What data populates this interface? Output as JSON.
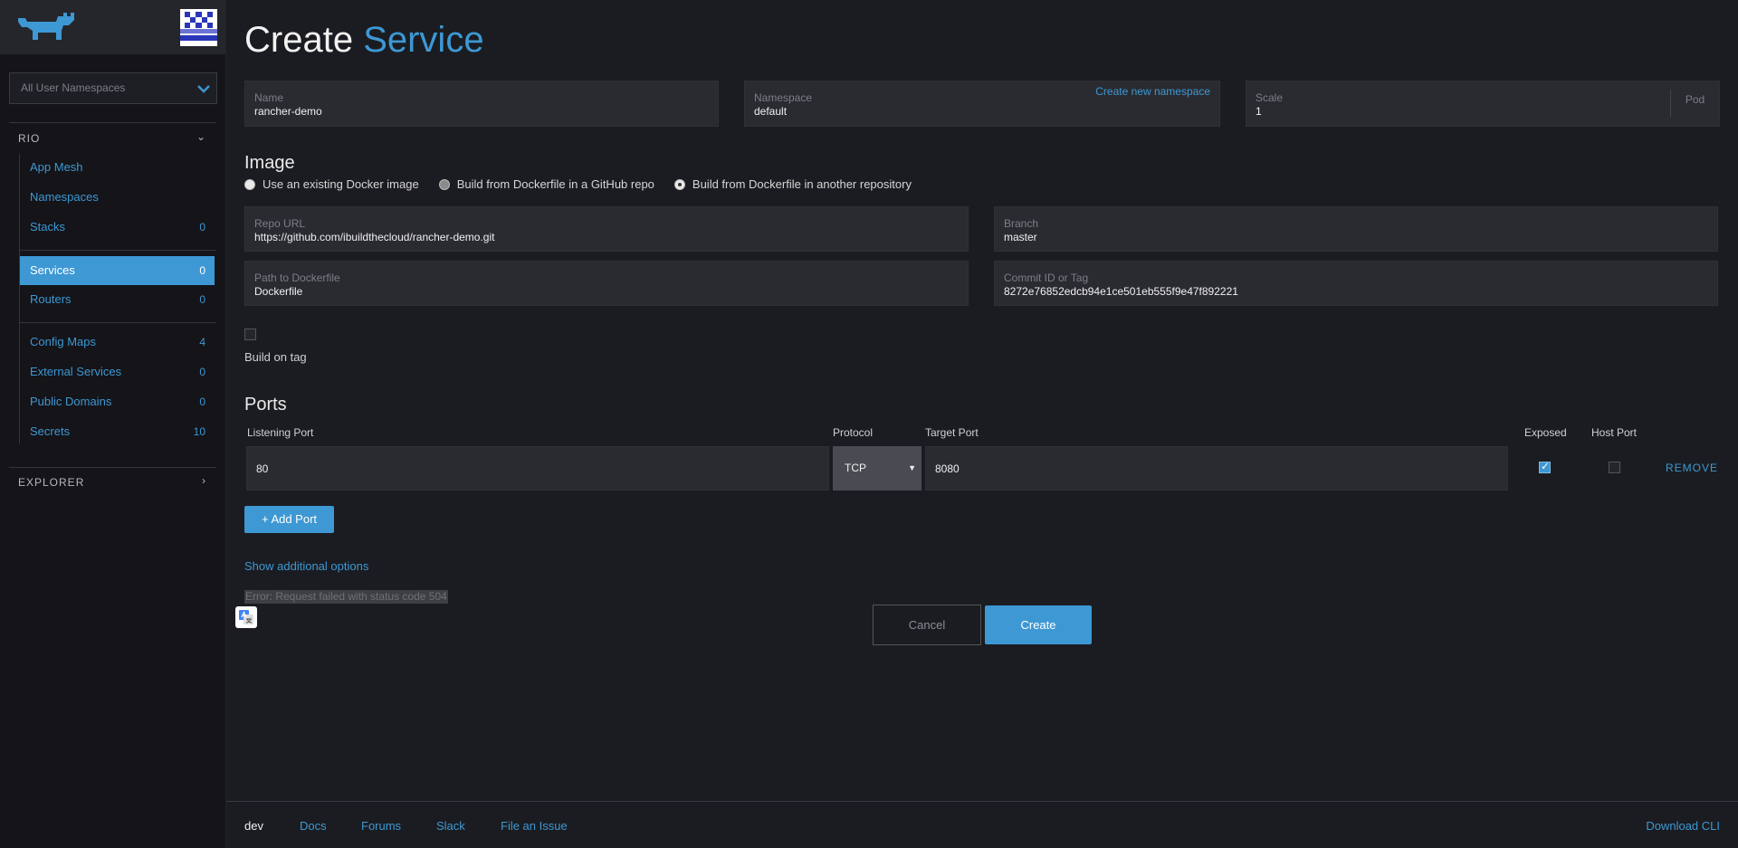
{
  "sidebar": {
    "namespace_select": "All User Namespaces",
    "groups": [
      {
        "title": "RIO",
        "caret": "⌄"
      },
      {
        "title": "EXPLORER",
        "caret": "›"
      }
    ],
    "items": [
      {
        "label": "App Mesh",
        "count": ""
      },
      {
        "label": "Namespaces",
        "count": ""
      },
      {
        "label": "Stacks",
        "count": "0"
      },
      {
        "label": "Services",
        "count": "0"
      },
      {
        "label": "Routers",
        "count": "0"
      },
      {
        "label": "Config Maps",
        "count": "4"
      },
      {
        "label": "External Services",
        "count": "0"
      },
      {
        "label": "Public Domains",
        "count": "0"
      },
      {
        "label": "Secrets",
        "count": "10"
      }
    ]
  },
  "page": {
    "title_prefix": "Create",
    "title_accent": "Service"
  },
  "form": {
    "name": {
      "label": "Name",
      "value": "rancher-demo"
    },
    "namespace": {
      "label": "Namespace",
      "value": "default",
      "link": "Create new namespace"
    },
    "scale": {
      "label": "Scale",
      "value": "1",
      "suffix": "Pod"
    },
    "image_heading": "Image",
    "image_options": [
      {
        "label": "Use an existing Docker image",
        "selected": false
      },
      {
        "label": "Build from Dockerfile in a GitHub repo",
        "selected": false
      },
      {
        "label": "Build from Dockerfile in another repository",
        "selected": true
      }
    ],
    "repo_url": {
      "label": "Repo URL",
      "value": "https://github.com/ibuildthecloud/rancher-demo.git"
    },
    "branch": {
      "label": "Branch",
      "value": "master"
    },
    "dockerfile": {
      "label": "Path to Dockerfile",
      "value": "Dockerfile"
    },
    "commit": {
      "label": "Commit ID or Tag",
      "value": "8272e76852edcb94e1ce501eb555f9e47f892221"
    },
    "build_on_tag": {
      "label": "Build on tag",
      "checked": false
    },
    "ports_heading": "Ports",
    "ports_columns": {
      "listening": "Listening Port",
      "protocol": "Protocol",
      "target": "Target Port",
      "exposed": "Exposed",
      "host": "Host Port"
    },
    "ports": [
      {
        "listening": "80",
        "protocol": "TCP",
        "target": "8080",
        "exposed": true,
        "host_port": false,
        "remove": "REMOVE"
      }
    ],
    "add_port": "+ Add Port",
    "show_options": "Show additional options",
    "error": "Error: Request failed with status code 504",
    "cancel": "Cancel",
    "create": "Create"
  },
  "footer": {
    "version": "dev",
    "links": [
      "Docs",
      "Forums",
      "Slack",
      "File an Issue"
    ],
    "download": "Download CLI"
  },
  "colors": {
    "accent": "#3d98d3",
    "background": "#1b1c21",
    "sidebar": "#141419"
  }
}
